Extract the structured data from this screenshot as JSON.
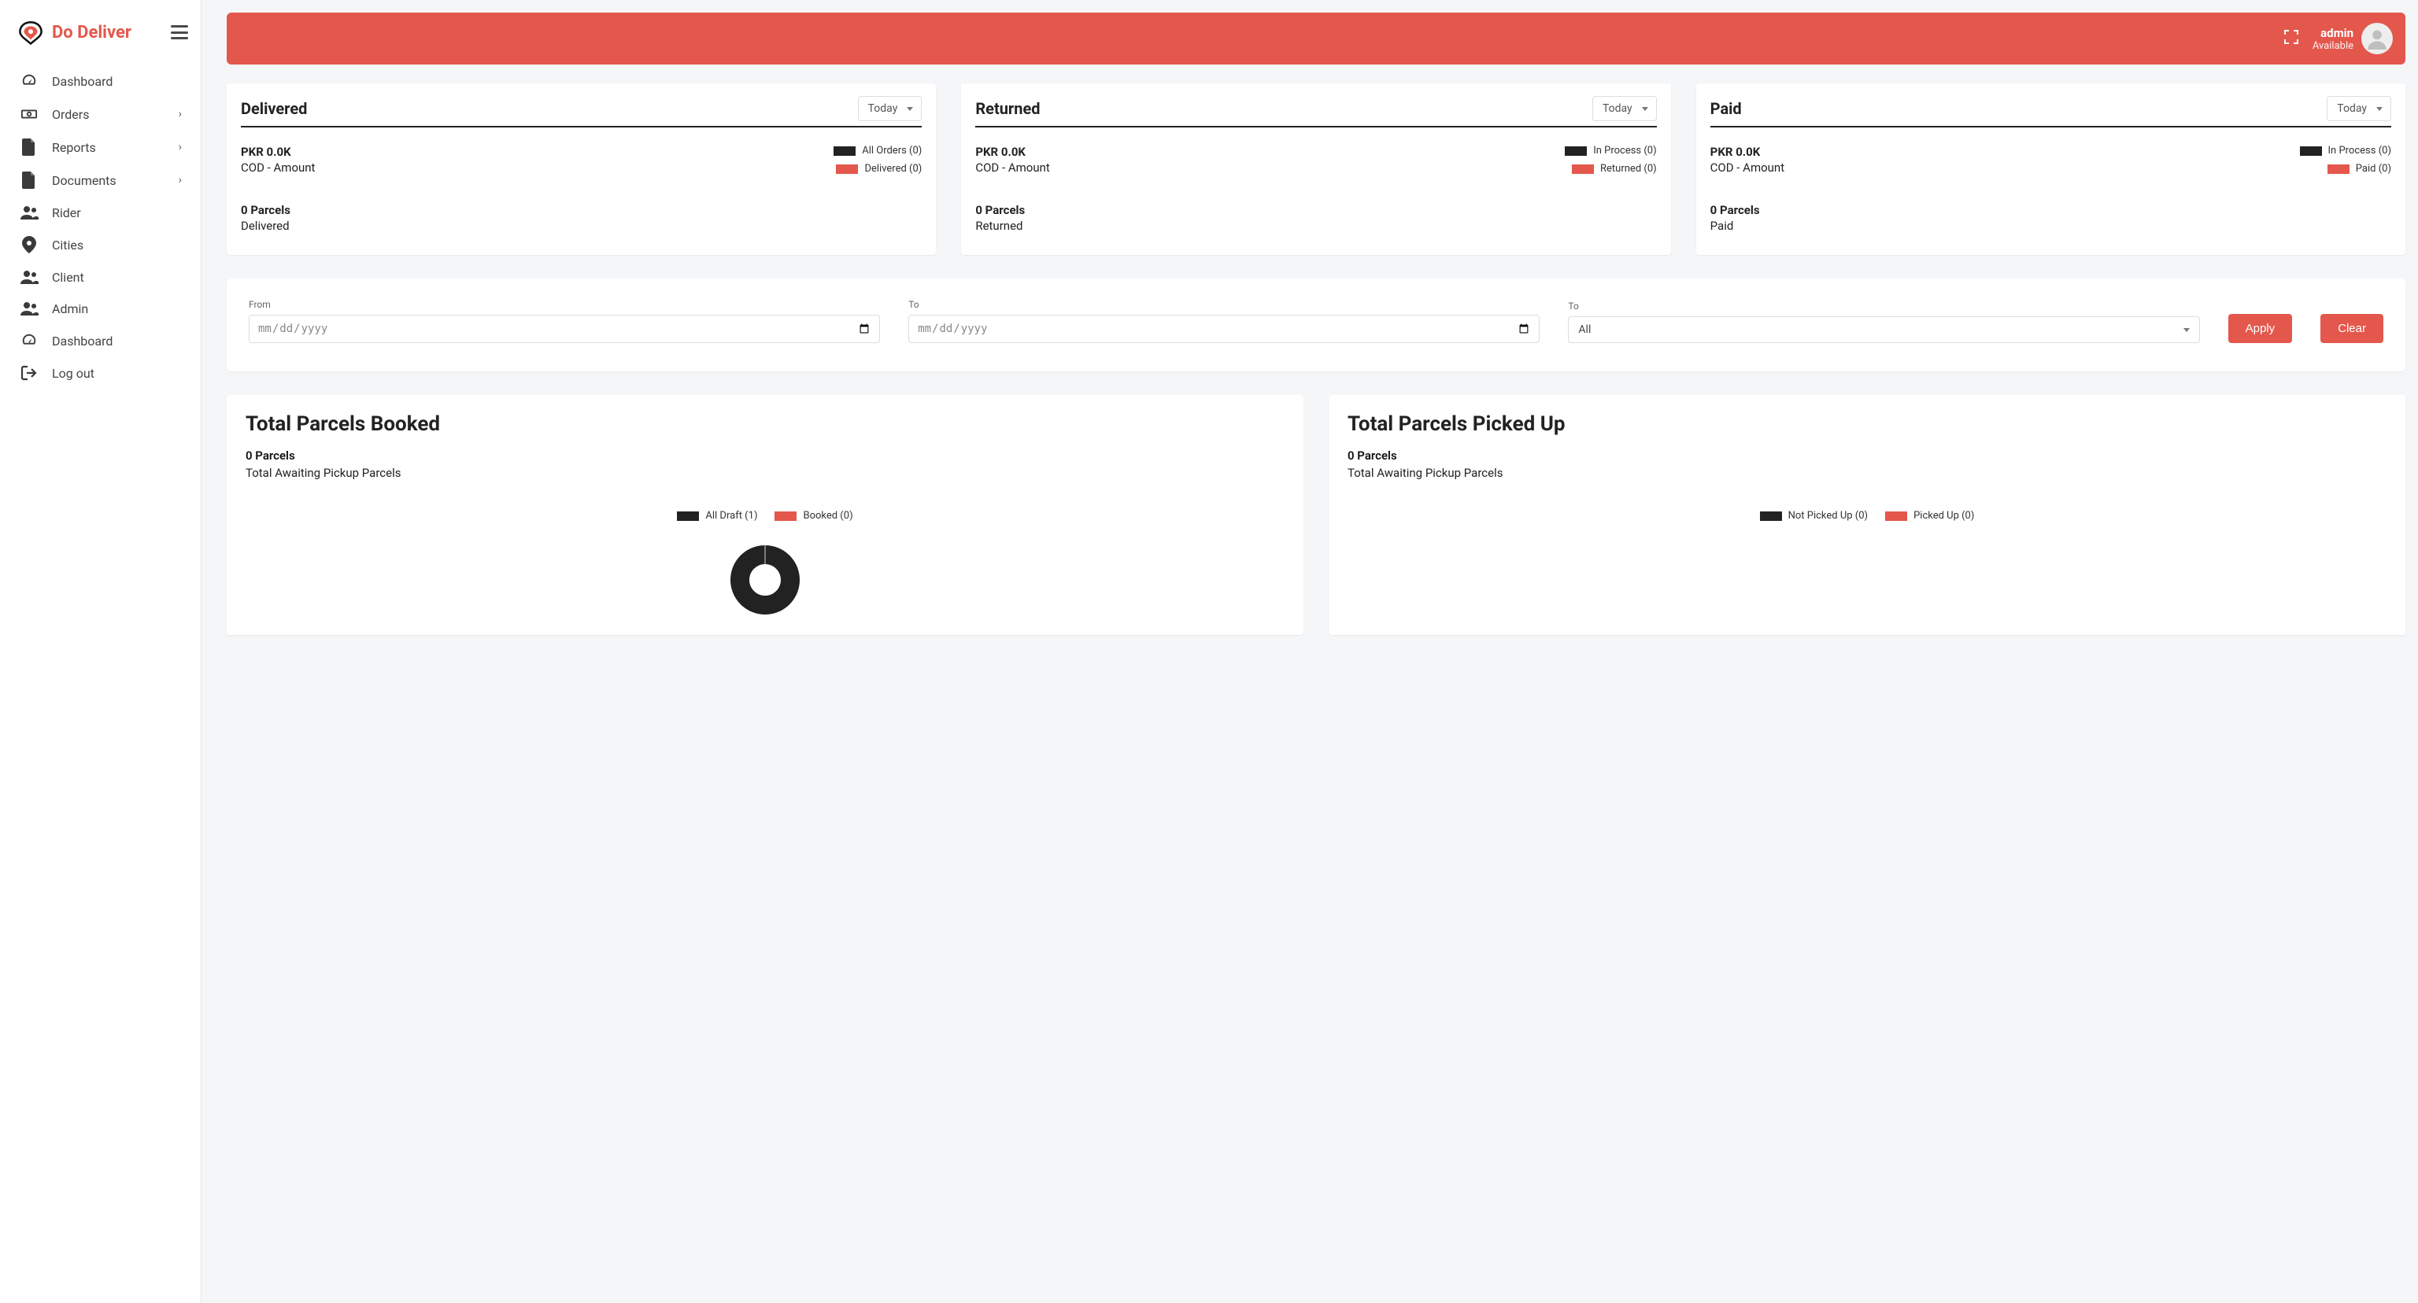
{
  "brand": {
    "name": "Do Deliver"
  },
  "sidebar": {
    "items": [
      {
        "label": "Dashboard",
        "caret": false
      },
      {
        "label": "Orders",
        "caret": true
      },
      {
        "label": "Reports",
        "caret": true
      },
      {
        "label": "Documents",
        "caret": true
      },
      {
        "label": "Rider",
        "caret": false
      },
      {
        "label": "Cities",
        "caret": false
      },
      {
        "label": "Client",
        "caret": false
      },
      {
        "label": "Admin",
        "caret": false
      },
      {
        "label": "Dashboard",
        "caret": false
      },
      {
        "label": "Log out",
        "caret": false
      }
    ]
  },
  "topbar": {
    "user_name": "admin",
    "user_status": "Available"
  },
  "cards": [
    {
      "title": "Delivered",
      "select": "Today",
      "amount": "PKR 0.0K",
      "amount_caption": "COD - Amount",
      "count": "0 Parcels",
      "count_caption": "Delivered",
      "legend": [
        {
          "label": "All Orders (0)"
        },
        {
          "label": "Delivered (0)"
        }
      ]
    },
    {
      "title": "Returned",
      "select": "Today",
      "amount": "PKR 0.0K",
      "amount_caption": "COD - Amount",
      "count": "0 Parcels",
      "count_caption": "Returned",
      "legend": [
        {
          "label": "In Process (0)"
        },
        {
          "label": "Returned (0)"
        }
      ]
    },
    {
      "title": "Paid",
      "select": "Today",
      "amount": "PKR 0.0K",
      "amount_caption": "COD - Amount",
      "count": "0 Parcels",
      "count_caption": "Paid",
      "legend": [
        {
          "label": "In Process (0)"
        },
        {
          "label": "Paid (0)"
        }
      ]
    }
  ],
  "filters": {
    "from_label": "From",
    "to_label": "To",
    "to2_label": "To",
    "date_placeholder": "mm/dd/yyyy",
    "select_value": "All",
    "apply": "Apply",
    "clear": "Clear"
  },
  "chart_data": [
    {
      "type": "pie",
      "title": "Total Parcels Booked",
      "sub1": "0 Parcels",
      "sub2": "Total Awaiting Pickup Parcels",
      "series": [
        {
          "name": "All Draft (1)",
          "value": 1,
          "color": "#222222"
        },
        {
          "name": "Booked (0)",
          "value": 0,
          "color": "#e4574c"
        }
      ]
    },
    {
      "type": "pie",
      "title": "Total Parcels Picked Up",
      "sub1": "0 Parcels",
      "sub2": "Total Awaiting Pickup Parcels",
      "series": [
        {
          "name": "Not Picked Up (0)",
          "value": 0,
          "color": "#222222"
        },
        {
          "name": "Picked Up (0)",
          "value": 0,
          "color": "#e4574c"
        }
      ]
    }
  ]
}
